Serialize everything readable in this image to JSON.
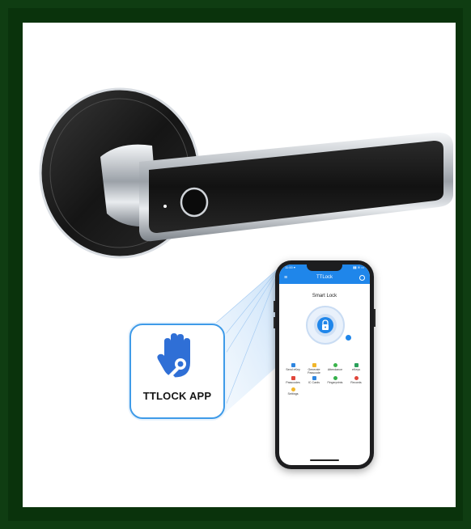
{
  "badge": {
    "label": "TTLOCK APP",
    "icon": "hand-key-icon",
    "color": "#2f6fd6",
    "border_color": "#3f9be8"
  },
  "phone_screen": {
    "status_time": "11:00 ▾",
    "status_icons": "▮▮ ≋ ▭",
    "app_title": "TTLock",
    "lock_name": "Smart Lock",
    "accent_color": "#1f86ea",
    "menu": [
      {
        "label": "Send eKey",
        "icon": "send-ekey-icon",
        "color": "#2f86e0"
      },
      {
        "label": "Generate Passcode",
        "icon": "passcode-generate-icon",
        "color": "#f1b62a"
      },
      {
        "label": "Attendance",
        "icon": "attendance-icon",
        "color": "#3ab44a"
      },
      {
        "label": "eKeys",
        "icon": "ekeys-icon",
        "color": "#2aa05a"
      },
      {
        "label": "Passcodes",
        "icon": "passcodes-icon",
        "color": "#e0463b"
      },
      {
        "label": "IC Cards",
        "icon": "ic-card-icon",
        "color": "#2f86e0"
      },
      {
        "label": "Fingerprints",
        "icon": "fingerprint-icon",
        "color": "#35b04b"
      },
      {
        "label": "Records",
        "icon": "records-icon",
        "color": "#e0463b"
      },
      {
        "label": "Settings",
        "icon": "settings-icon",
        "color": "#f1b62a"
      }
    ]
  },
  "product": {
    "name_icon": "door-handle-fingerprint-lock",
    "handle_color": "#1b1b1b",
    "chrome_color": "#c8ccd2"
  }
}
